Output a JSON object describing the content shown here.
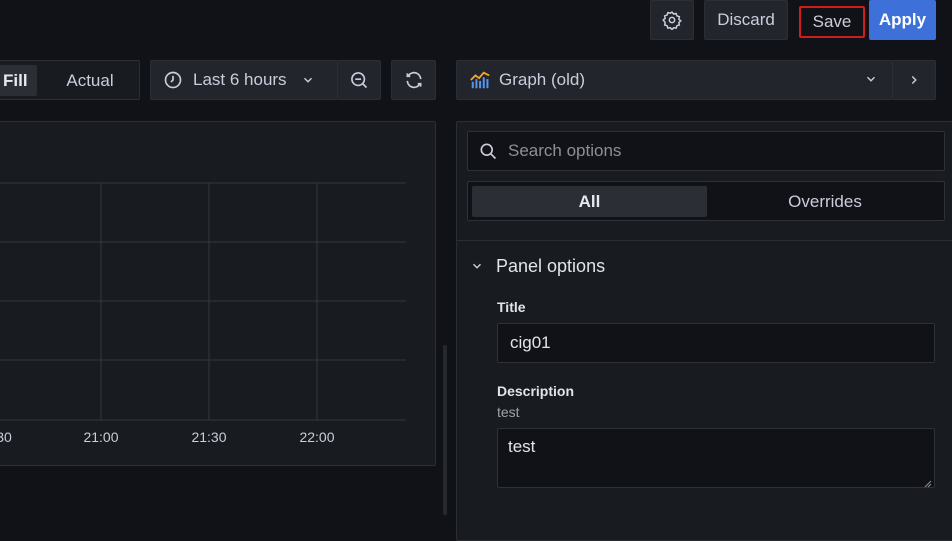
{
  "toolbar": {
    "settings_icon": "gear-icon",
    "discard_label": "Discard",
    "save_label": "Save",
    "apply_label": "Apply"
  },
  "view_toggle": {
    "options": [
      "Fill",
      "Actual"
    ],
    "selected": "Fill"
  },
  "time_picker": {
    "label": "Last 6 hours",
    "icon": "clock-icon"
  },
  "visualization": {
    "label": "Graph (old)",
    "icon": "graph-icon",
    "icon_color": "#f2a529"
  },
  "graph": {
    "x_ticks": [
      "30",
      "21:00",
      "21:30",
      "22:00"
    ]
  },
  "options": {
    "search_placeholder": "Search options",
    "tabs": [
      "All",
      "Overrides"
    ],
    "active_tab": "All",
    "section_title": "Panel options",
    "title_label": "Title",
    "title_value": "cig01",
    "description_label": "Description",
    "description_hint": "test",
    "description_value": "test"
  },
  "colors": {
    "background": "#111217",
    "panel": "#181b1f",
    "primary": "#3d71d9",
    "highlight_border": "#d01c1c"
  }
}
